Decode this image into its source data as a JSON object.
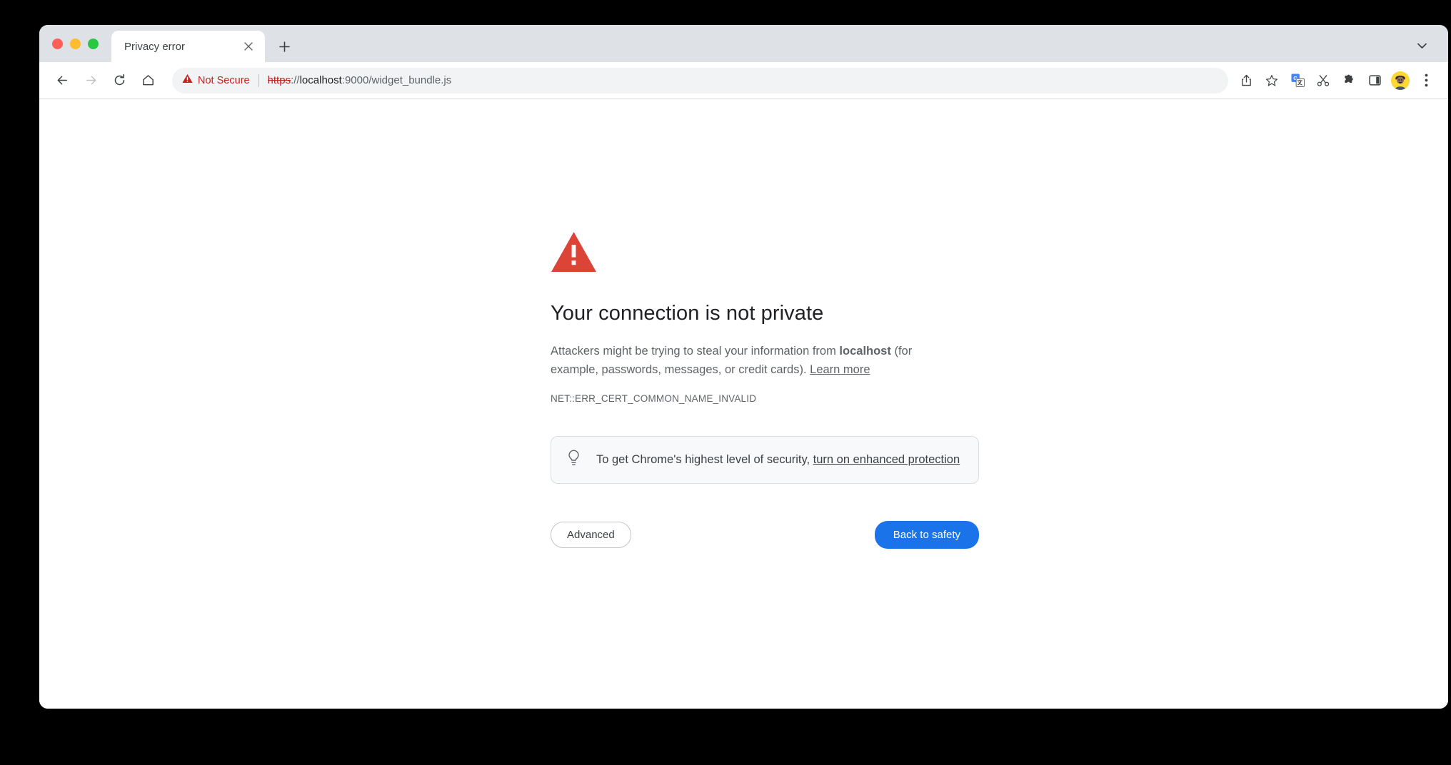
{
  "window": {
    "traffic_lights": [
      "close",
      "minimize",
      "maximize"
    ],
    "colors": {
      "tab_strip_bg": "#dee1e6",
      "accent_blue": "#1a73e8",
      "warning_red": "#db4437",
      "not_secure_red": "#c5221f",
      "text_primary": "#202124",
      "text_secondary": "#5f6368",
      "desktop_bg": "#000000"
    }
  },
  "tabstrip": {
    "tab_title": "Privacy error",
    "close_tab_label": "×",
    "new_tab_label": "+",
    "tab_search_label": "Search tabs"
  },
  "toolbar": {
    "back_label": "Back",
    "forward_label": "Forward",
    "reload_label": "Reload",
    "home_label": "Home",
    "security_label": "Not Secure",
    "url_scheme": "https",
    "url_rest": "://",
    "url_host": "localhost",
    "url_path": ":9000/widget_bundle.js",
    "url_full": "https://localhost:9000/widget_bundle.js",
    "icons": [
      "share-icon",
      "bookmark-star-icon",
      "google-translate-icon",
      "scissors-icon",
      "extensions-puzzle-icon",
      "side-panel-icon",
      "profile-avatar",
      "three-dot-menu-icon"
    ]
  },
  "interstitial": {
    "icon": "warning-triangle-icon",
    "heading": "Your connection is not private",
    "body_part1": "Attackers might be trying to steal your information from ",
    "body_host": "localhost",
    "body_part2": " (for example, passwords, messages, or credit cards). ",
    "learn_more": "Learn more",
    "error_code": "NET::ERR_CERT_COMMON_NAME_INVALID",
    "enhanced_protection": {
      "icon": "lightbulb-icon",
      "text": "To get Chrome's highest level of security, ",
      "link": "turn on enhanced protection"
    },
    "advanced_button": "Advanced",
    "back_to_safety_button": "Back to safety"
  }
}
